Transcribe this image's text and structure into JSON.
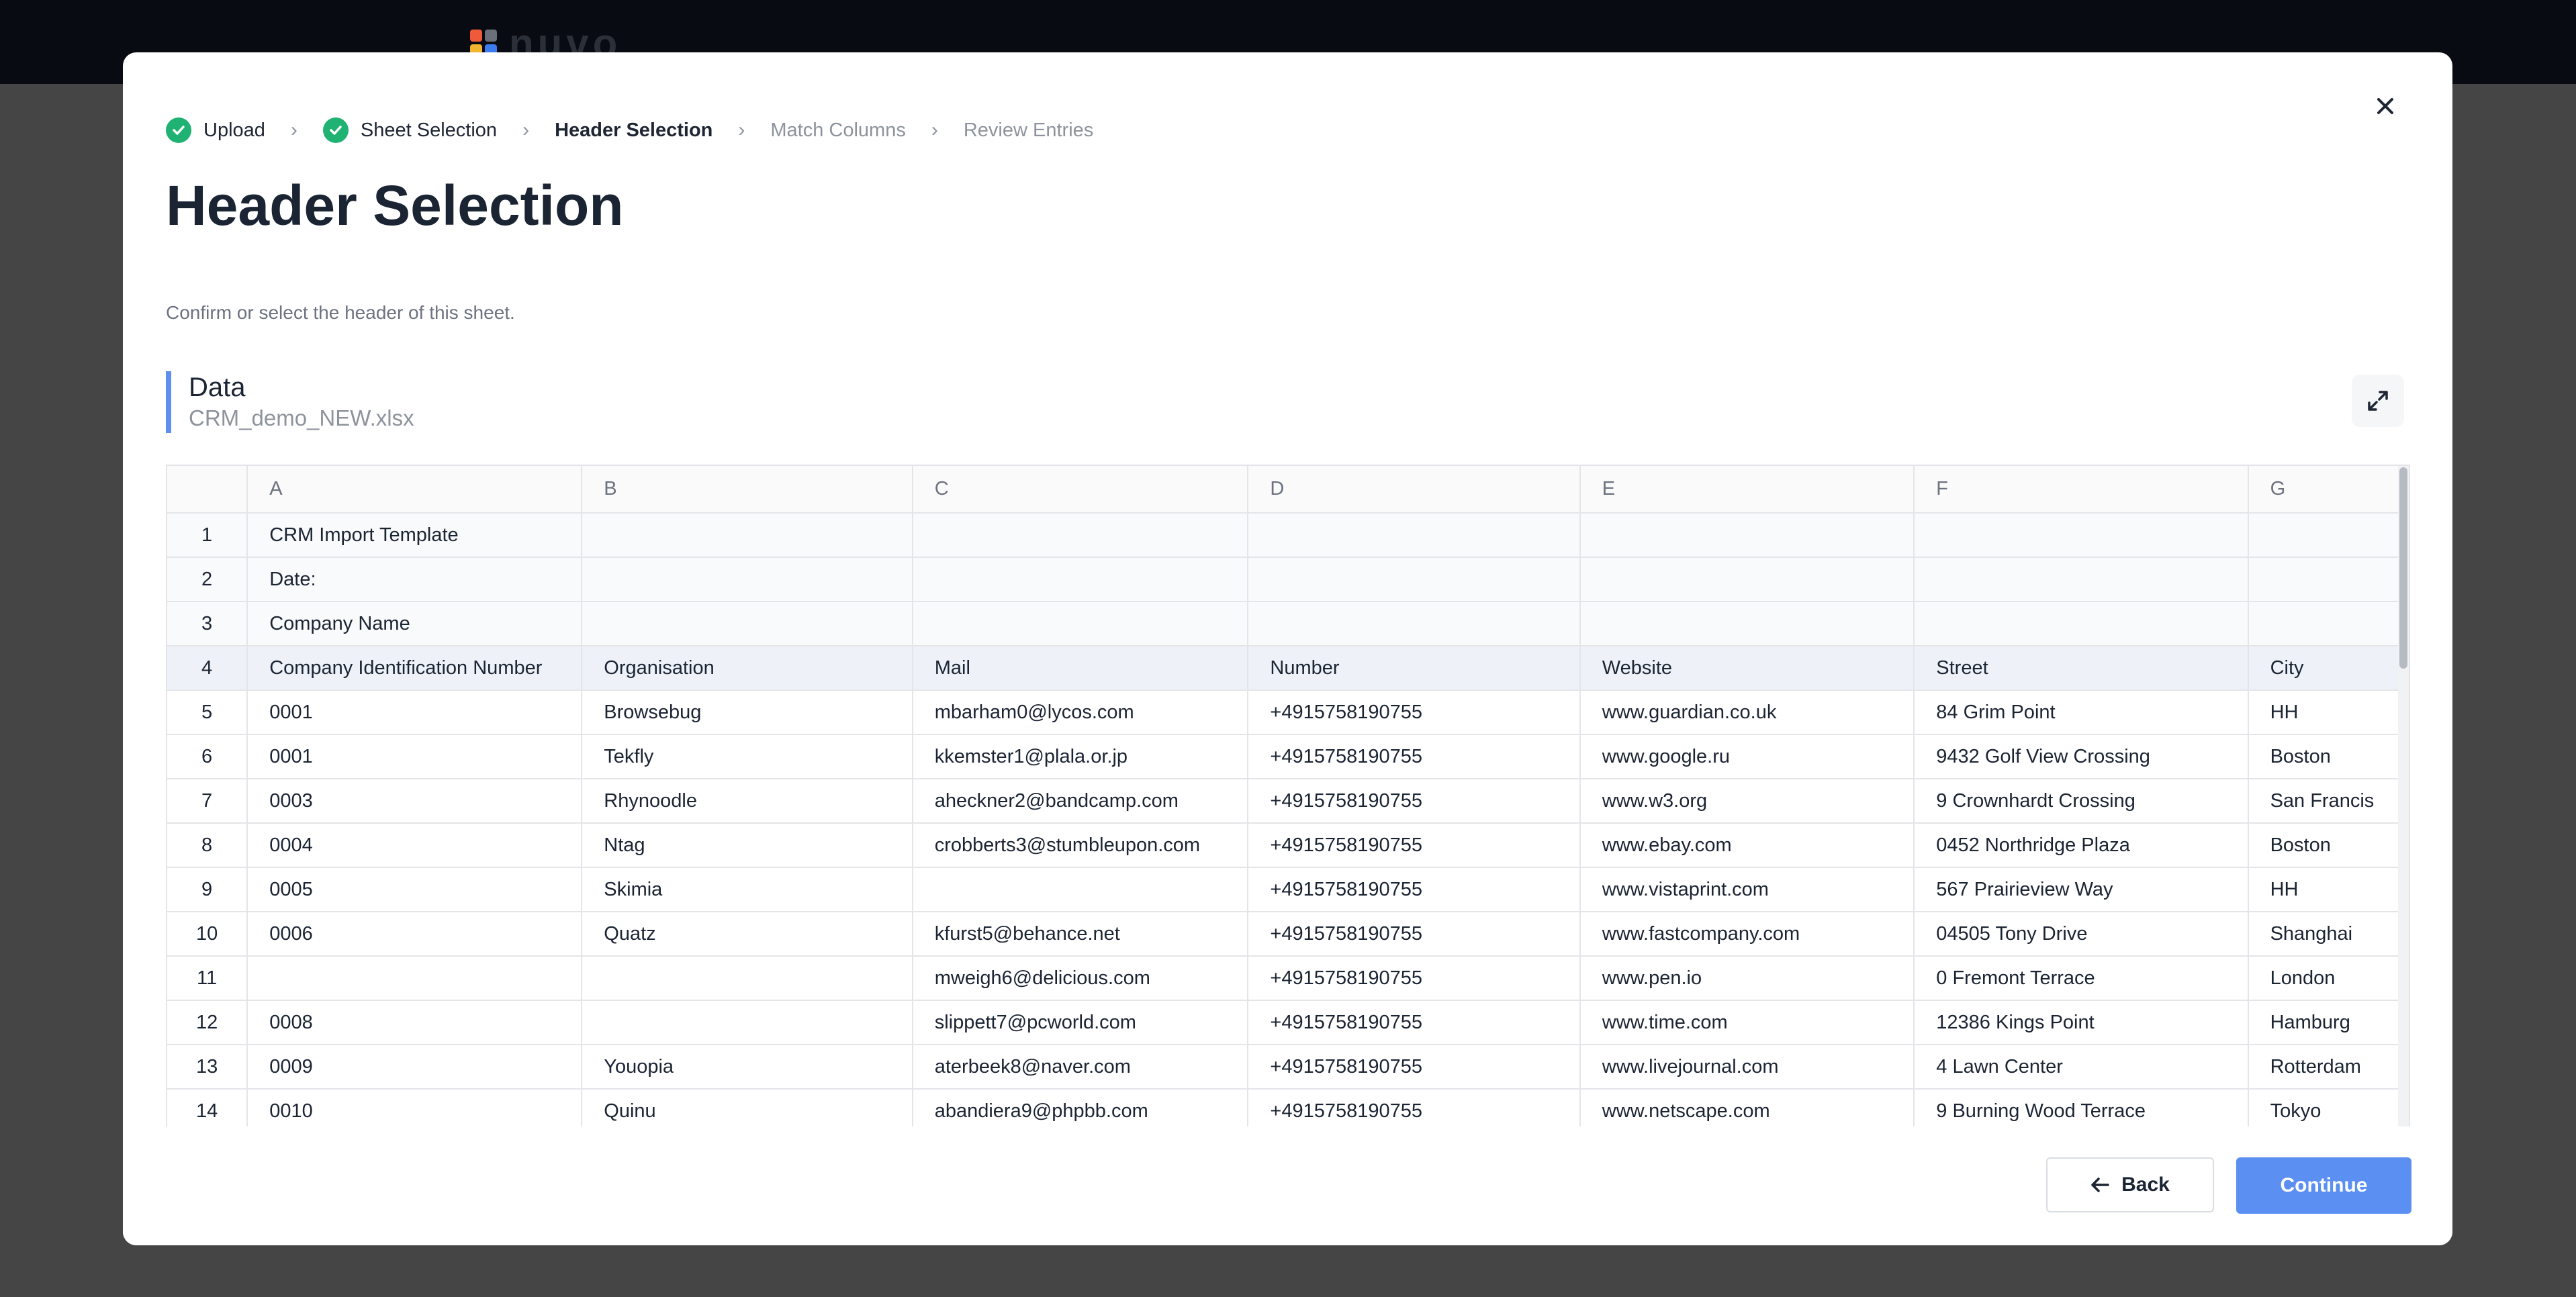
{
  "app": {
    "logo_text": "nuvo"
  },
  "stepper": {
    "steps": [
      {
        "label": "Upload",
        "state": "done"
      },
      {
        "label": "Sheet Selection",
        "state": "done"
      },
      {
        "label": "Header Selection",
        "state": "active"
      },
      {
        "label": "Match Columns",
        "state": "todo"
      },
      {
        "label": "Review Entries",
        "state": "todo"
      }
    ]
  },
  "page": {
    "title": "Header Selection",
    "subtitle": "Confirm or select the header of this sheet."
  },
  "sheet": {
    "name": "Data",
    "file": "CRM_demo_NEW.xlsx"
  },
  "table": {
    "columns": [
      "A",
      "B",
      "C",
      "D",
      "E",
      "F",
      "G"
    ],
    "rows": [
      {
        "num": "1",
        "cells": [
          "CRM Import Template",
          "",
          "",
          "",
          "",
          "",
          ""
        ]
      },
      {
        "num": "2",
        "cells": [
          "Date:",
          "",
          "",
          "",
          "",
          "",
          ""
        ]
      },
      {
        "num": "3",
        "cells": [
          "Company Name",
          "",
          "",
          "",
          "",
          "",
          ""
        ]
      },
      {
        "num": "4",
        "cells": [
          "Company Identification Number",
          "Organisation",
          "Mail",
          "Number",
          "Website",
          "Street",
          "City"
        ]
      },
      {
        "num": "5",
        "cells": [
          "0001",
          "Browsebug",
          "mbarham0@lycos.com",
          "+4915758190755",
          "www.guardian.co.uk",
          "84 Grim Point",
          "HH"
        ]
      },
      {
        "num": "6",
        "cells": [
          "0001",
          "Tekfly",
          "kkemster1@plala.or.jp",
          "+4915758190755",
          "www.google.ru",
          "9432 Golf View Crossing",
          "Boston"
        ]
      },
      {
        "num": "7",
        "cells": [
          "0003",
          "Rhynoodle",
          "aheckner2@bandcamp.com",
          "+4915758190755",
          "www.w3.org",
          "9 Crownhardt Crossing",
          "San Francis"
        ]
      },
      {
        "num": "8",
        "cells": [
          "0004",
          "Ntag",
          "crobberts3@stumbleupon.com",
          "+4915758190755",
          "www.ebay.com",
          "0452 Northridge Plaza",
          "Boston"
        ]
      },
      {
        "num": "9",
        "cells": [
          "0005",
          "Skimia",
          "",
          "+4915758190755",
          "www.vistaprint.com",
          "567 Prairieview Way",
          "HH"
        ]
      },
      {
        "num": "10",
        "cells": [
          "0006",
          "Quatz",
          "kfurst5@behance.net",
          "+4915758190755",
          "www.fastcompany.com",
          "04505 Tony Drive",
          "Shanghai"
        ]
      },
      {
        "num": "11",
        "cells": [
          "",
          "",
          "mweigh6@delicious.com",
          "+4915758190755",
          "www.pen.io",
          "0 Fremont Terrace",
          "London"
        ]
      },
      {
        "num": "12",
        "cells": [
          "0008",
          "",
          "slippett7@pcworld.com",
          "+4915758190755",
          "www.time.com",
          "12386 Kings Point",
          "Hamburg"
        ]
      },
      {
        "num": "13",
        "cells": [
          "0009",
          "Youopia",
          "aterbeek8@naver.com",
          "+4915758190755",
          "www.livejournal.com",
          "4 Lawn Center",
          "Rotterdam"
        ]
      },
      {
        "num": "14",
        "cells": [
          "0010",
          "Quinu",
          "abandiera9@phpbb.com",
          "+4915758190755",
          "www.netscape.com",
          "9 Burning Wood Terrace",
          "Tokyo"
        ]
      }
    ],
    "selected_row": "4"
  },
  "footer": {
    "back_label": "Back",
    "continue_label": "Continue"
  },
  "colors": {
    "accent": "#5b8ff1",
    "success": "#20b273",
    "selected_row": "#eef2f8"
  }
}
